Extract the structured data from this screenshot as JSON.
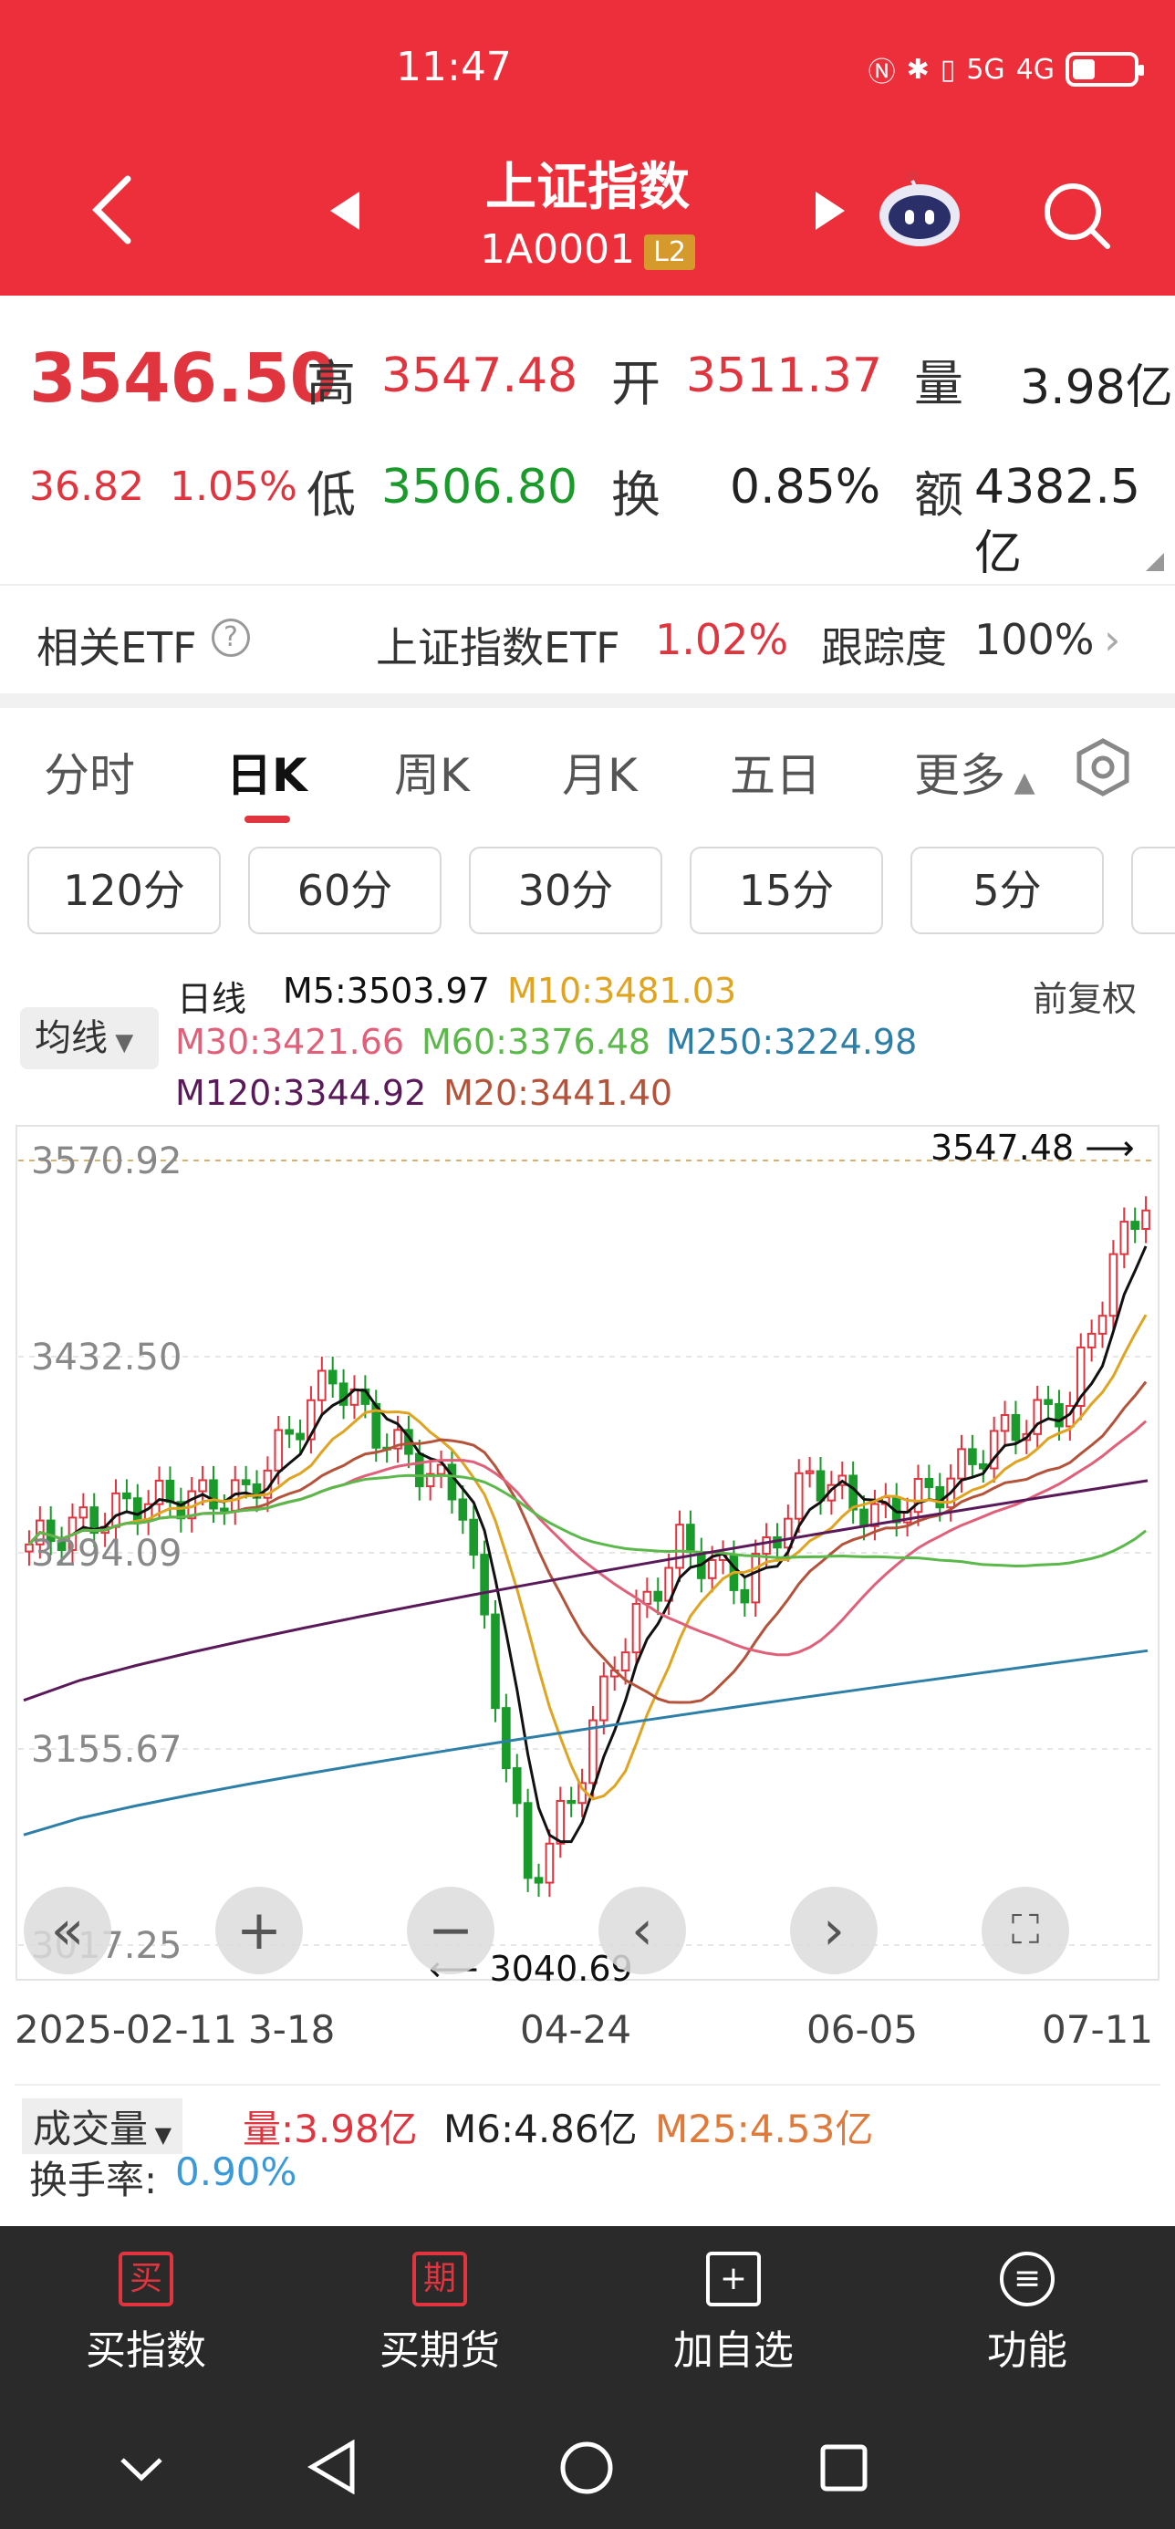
{
  "status": {
    "time": "11:47",
    "net": "5G",
    "net2": "4G"
  },
  "header": {
    "title": "上证指数",
    "code": "1A0001",
    "badge": "L2"
  },
  "quote": {
    "price": "3546.50",
    "change": "36.82",
    "change_pct": "1.05%",
    "high_label": "高",
    "high": "3547.48",
    "open_label": "开",
    "open": "3511.37",
    "vol_label": "量",
    "vol": "3.98亿",
    "low_label": "低",
    "low": "3506.80",
    "turn_label": "换",
    "turn": "0.85%",
    "amt_label": "额",
    "amt": "4382.5亿"
  },
  "etf": {
    "label": "相关ETF",
    "name": "上证指数ETF",
    "pct": "1.02%",
    "track_label": "跟踪度",
    "track": "100%"
  },
  "tabs": [
    "分时",
    "日K",
    "周K",
    "月K",
    "五日",
    "更多"
  ],
  "subtabs": [
    "120分",
    "60分",
    "30分",
    "15分",
    "5分"
  ],
  "legend": {
    "period": "日线",
    "adjust": "前复权",
    "ma_button": "均线",
    "m5": "M5:3503.97",
    "m10": "M10:3481.03",
    "m30": "M30:3421.66",
    "m60": "M60:3376.48",
    "m250": "M250:3224.98",
    "m120": "M120:3344.92",
    "m20": "M20:3441.40"
  },
  "chart_data": {
    "type": "candlestick",
    "y_ticks": [
      "3570.92",
      "3432.50",
      "3294.09",
      "3155.67",
      "3017.25"
    ],
    "x_ticks": [
      "2025-02-11",
      "3-18",
      "04-24",
      "06-05",
      "07-11"
    ],
    "max_label": "3547.48",
    "min_label": "3040.69",
    "ylim": [
      3017.25,
      3570.92
    ]
  },
  "volume": {
    "label": "成交量",
    "vol": "量:3.98亿",
    "m6": "M6:4.86亿",
    "m25": "M25:4.53亿",
    "turn_label": "换手率:",
    "turn": "0.90%"
  },
  "actions": [
    {
      "icon": "买",
      "label": "买指数"
    },
    {
      "icon": "期",
      "label": "买期货"
    },
    {
      "icon": "+",
      "label": "加自选"
    },
    {
      "icon": "≡",
      "label": "功能"
    }
  ],
  "colors": {
    "header": "#ec2f3b",
    "up": "#e0353f",
    "down": "#1a9a2a",
    "m5": "#111111",
    "m10": "#e0a420",
    "m20": "#b5523a",
    "m30": "#e0607a",
    "m60": "#5bb84a",
    "m120": "#5a1a5a",
    "m250": "#2d7fa8"
  }
}
